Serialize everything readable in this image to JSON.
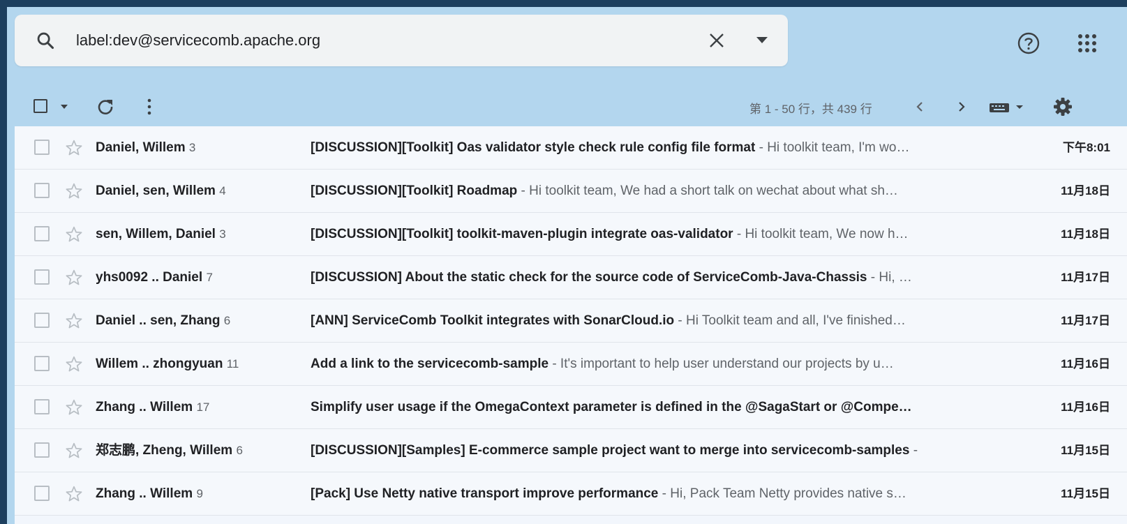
{
  "search": {
    "query": "label:dev@servicecomb.apache.org"
  },
  "toolbar": {
    "range": "第 1 - 50 行，共 439 行"
  },
  "icons": {
    "search": "search-icon",
    "clear": "close-icon",
    "dropdown": "caret-down-icon",
    "help": "help-icon",
    "apps": "apps-grid-icon",
    "refresh": "refresh-icon",
    "more": "more-vert-icon",
    "prev": "chevron-left-icon",
    "next": "chevron-right-icon",
    "keyboard": "keyboard-icon",
    "settings": "gear-icon",
    "star": "star-outline-icon"
  },
  "colors": {
    "background": "#b3d6ee",
    "outer": "#1d3f5e",
    "row": "#f5f8fc"
  },
  "emails": [
    {
      "sender": "Daniel, Willem",
      "count": "3",
      "subject": "[DISCUSSION][Toolkit] Oas validator style check rule config file format",
      "snippet": " - Hi toolkit team, I'm wo…",
      "date": "下午8:01"
    },
    {
      "sender": "Daniel, sen, Willem",
      "count": "4",
      "subject": "[DISCUSSION][Toolkit] Roadmap",
      "snippet": " - Hi toolkit team, We had a short talk on wechat about what sh…",
      "date": "11月18日"
    },
    {
      "sender": "sen, Willem, Daniel",
      "count": "3",
      "subject": "[DISCUSSION][Toolkit] toolkit-maven-plugin integrate oas-validator",
      "snippet": " - Hi toolkit team, We now h…",
      "date": "11月18日"
    },
    {
      "sender": "yhs0092 .. Daniel",
      "count": "7",
      "subject": "[DISCUSSION] About the static check for the source code of ServiceComb-Java-Chassis",
      "snippet": " - Hi, …",
      "date": "11月17日"
    },
    {
      "sender": "Daniel .. sen, Zhang",
      "count": "6",
      "subject": "[ANN] ServiceComb Toolkit integrates with SonarCloud.io",
      "snippet": " - Hi Toolkit team and all, I've finished…",
      "date": "11月17日"
    },
    {
      "sender": "Willem .. zhongyuan",
      "count": "11",
      "subject": "Add a link to the servicecomb-sample",
      "snippet": " - It's important to help user understand our projects by u…",
      "date": "11月16日"
    },
    {
      "sender": "Zhang .. Willem",
      "count": "17",
      "subject": "Simplify user usage if the OmegaContext parameter is defined in the @SagaStart or @Compe…",
      "snippet": "",
      "date": "11月16日"
    },
    {
      "sender": "郑志鹏, Zheng, Willem",
      "count": "6",
      "subject": "[DISCUSSION][Samples] E-commerce sample project want to merge into servicecomb-samples",
      "snippet": " -",
      "date": "11月15日"
    },
    {
      "sender": "Zhang .. Willem",
      "count": "9",
      "subject": "[Pack] Use Netty native transport improve performance",
      "snippet": " - Hi, Pack Team Netty provides native s…",
      "date": "11月15日"
    }
  ]
}
